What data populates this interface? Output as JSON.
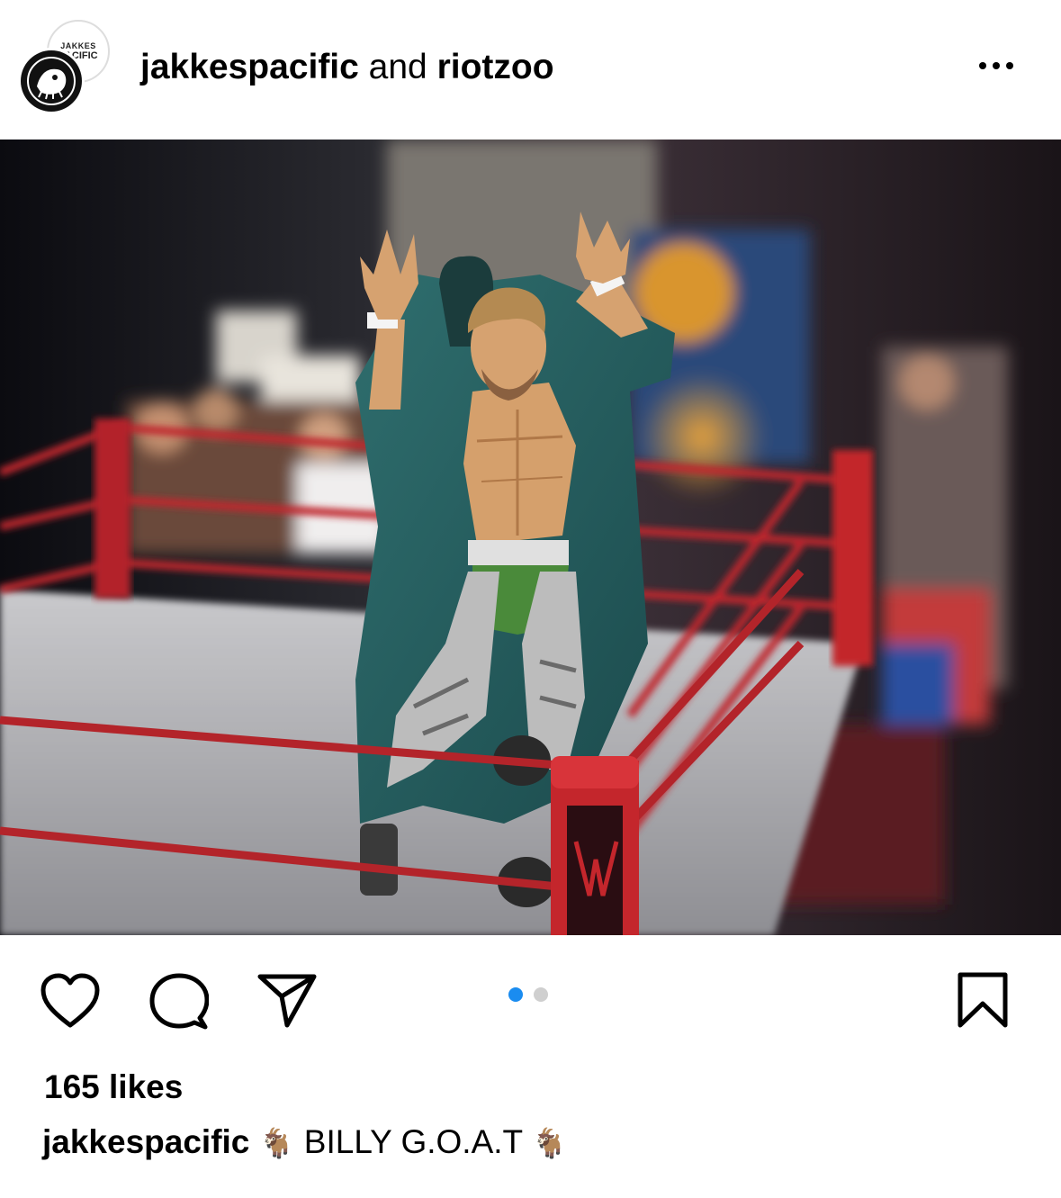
{
  "post": {
    "author_primary": "jakkespacific",
    "joiner": " and ",
    "author_secondary": "riotzoo",
    "avatar_brand_top": "JAKKES",
    "avatar_brand_bottom": "PACIFIC",
    "more_icon": "more-horizontal-icon"
  },
  "media": {
    "carousel_total": 2,
    "carousel_active_index": 1
  },
  "actions": {
    "like_icon": "heart-icon",
    "comment_icon": "comment-bubble-icon",
    "share_icon": "paper-plane-icon",
    "save_icon": "bookmark-icon"
  },
  "likes_text": "165 likes",
  "caption": {
    "username": "jakkespacific",
    "emoji_1": "🐐",
    "text": "BILLY G.O.A.T",
    "emoji_2": "🐐"
  },
  "colors": {
    "carousel_active": "#1a8cf0",
    "carousel_inactive": "#cfcfcf"
  }
}
